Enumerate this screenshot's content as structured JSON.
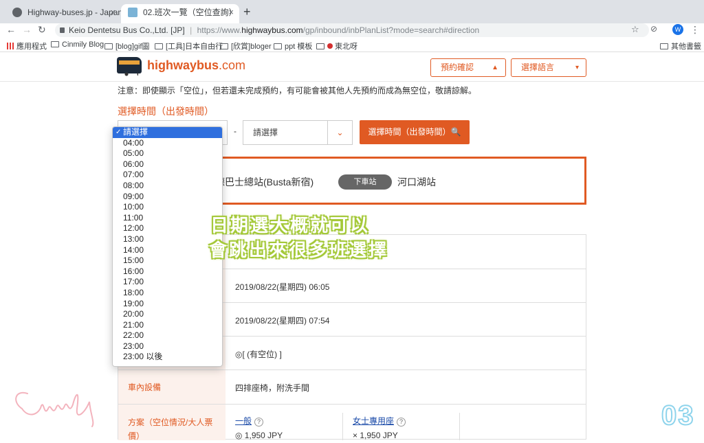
{
  "browser": {
    "tabs": [
      {
        "title": "Highway-buses.jp - Japan",
        "close": "×"
      },
      {
        "title": "02.班次一覽（空位查詢）",
        "close": "×"
      }
    ],
    "new_tab": "+",
    "nav": {
      "back": "←",
      "forward": "→",
      "reload": "↻"
    },
    "site_label": "Keio Dentetsu Bus Co.,Ltd. [JP]",
    "separator": "|",
    "url_scheme": "https://www.",
    "url_domain": "highwaybus.com",
    "url_path": "/gp/inbound/inbPlanList?mode=search#direction",
    "star": "☆",
    "profile": "W",
    "menu": "⋮",
    "ext": "⊘"
  },
  "bookmarks": [
    {
      "label": "應用程式"
    },
    {
      "label": "Cinmily Blog"
    },
    {
      "label": "[blog]gif圖"
    },
    {
      "label": "[工具]日本自由行"
    },
    {
      "label": "[欣賞]bloger"
    },
    {
      "label": "ppt 模板"
    },
    {
      "label": "東北呀"
    }
  ],
  "bookmarks_right": "其他書籤",
  "header": {
    "logo_bold": "highwaybus",
    "logo_suffix": ".com",
    "reserve_label": "預約確認",
    "reserve_icon": "▲",
    "language_label": "選擇語言",
    "language_icon": "▾"
  },
  "notice": "注意：即使顯示「空位」，但若還未完成預約，有可能會被其他人先預約而成為無空位，敬請諒解。",
  "time_section": {
    "title": "選擇時間（出發時間）",
    "dash": "-",
    "second_select": "請選擇",
    "arrow": "⌄",
    "search_button": "選擇時間（出發時間）🔍"
  },
  "route": {
    "from": "德巴士總站(Busta新宿)",
    "badge": "下車站",
    "to": "河口湖站"
  },
  "dropdown": {
    "check": "✓",
    "options": [
      "請選擇",
      "04:00",
      "05:00",
      "06:00",
      "07:00",
      "08:00",
      "09:00",
      "10:00",
      "11:00",
      "12:00",
      "13:00",
      "14:00",
      "15:00",
      "16:00",
      "17:00",
      "18:00",
      "19:00",
      "20:00",
      "21:00",
      "22:00",
      "23:00",
      "23:00 以後"
    ]
  },
  "table": {
    "departure": "2019/08/22(星期四) 06:05",
    "arrival": "2019/08/22(星期四) 07:54",
    "availability": "◎[ (有空位) ]",
    "facilities_label": "車內設備",
    "facilities_value": "四排座椅，附洗手間",
    "plan_label": "方案（空位情況/大人票價）",
    "plans": [
      {
        "name": "一般",
        "q": "?",
        "price": "◎ 1,950 JPY"
      },
      {
        "name": "女士專用座",
        "q": "?",
        "price": "× 1,950 JPY"
      }
    ]
  },
  "overlay": {
    "line1": "日期選大概就可以",
    "line2": "會跳出來很多班選擇"
  },
  "watermark": {
    "page_number": "03"
  },
  "colors": {
    "brand": "#e05a23",
    "selected_option": "#2f6fde",
    "overlay_outline": "#a5c93a",
    "page_number_outline": "#8fd4ec"
  }
}
